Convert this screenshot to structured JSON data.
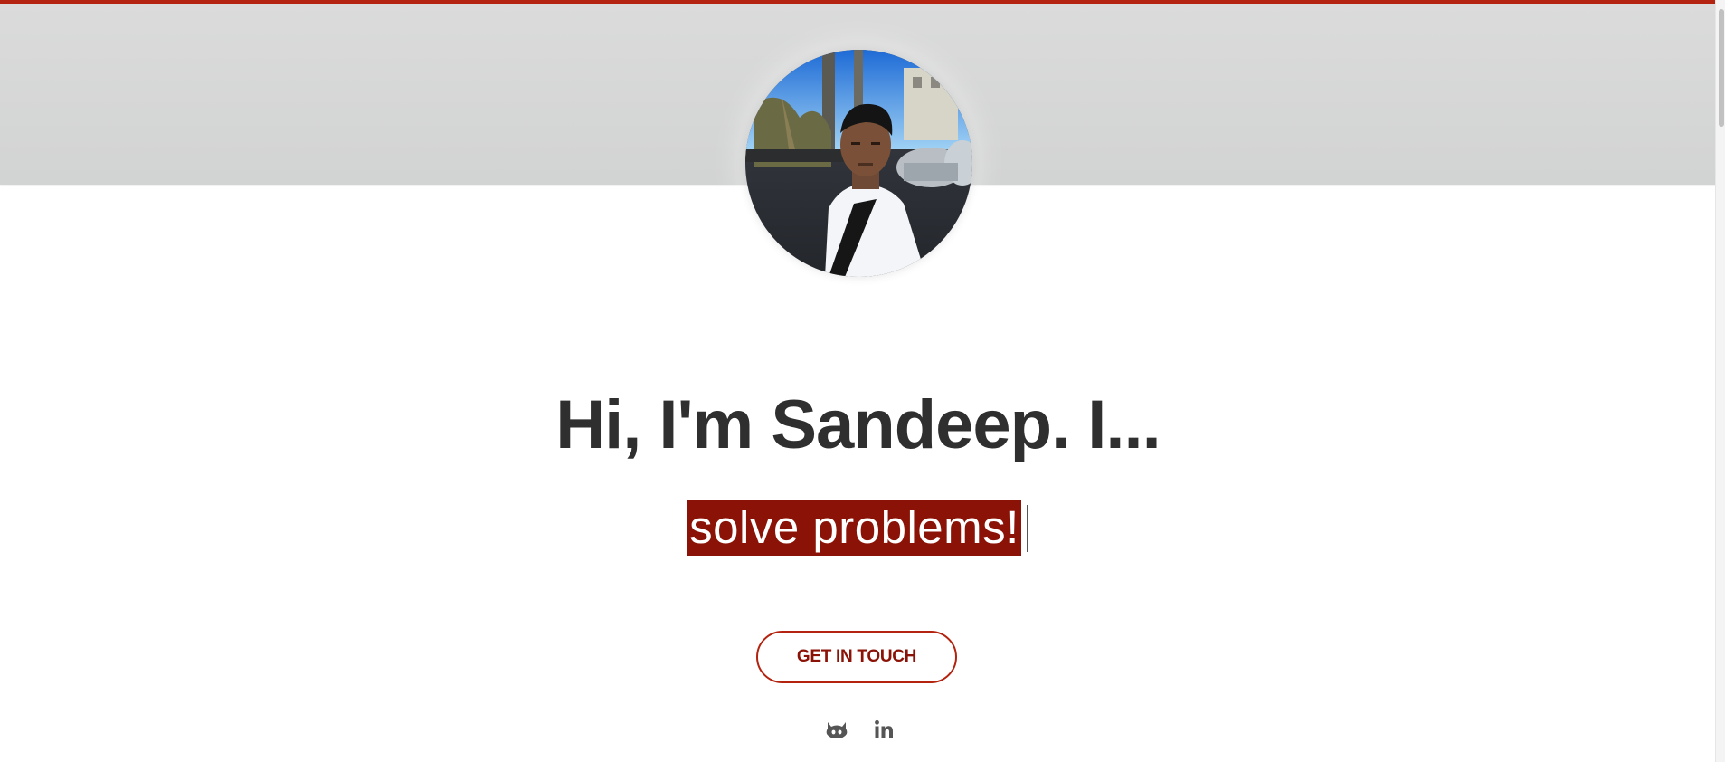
{
  "hero": {
    "headline": "Hi, I'm Sandeep. I...",
    "typed_text": "solve problems!",
    "cta_label": "GET IN TOUCH"
  },
  "social_links": [
    {
      "icon": "github-icon"
    },
    {
      "icon": "linkedin-icon"
    }
  ],
  "colors": {
    "accent": "#b3230f",
    "typed_highlight": "#8b1206",
    "headline": "#2f2f2f",
    "hero_band": "#d4d5d5"
  }
}
